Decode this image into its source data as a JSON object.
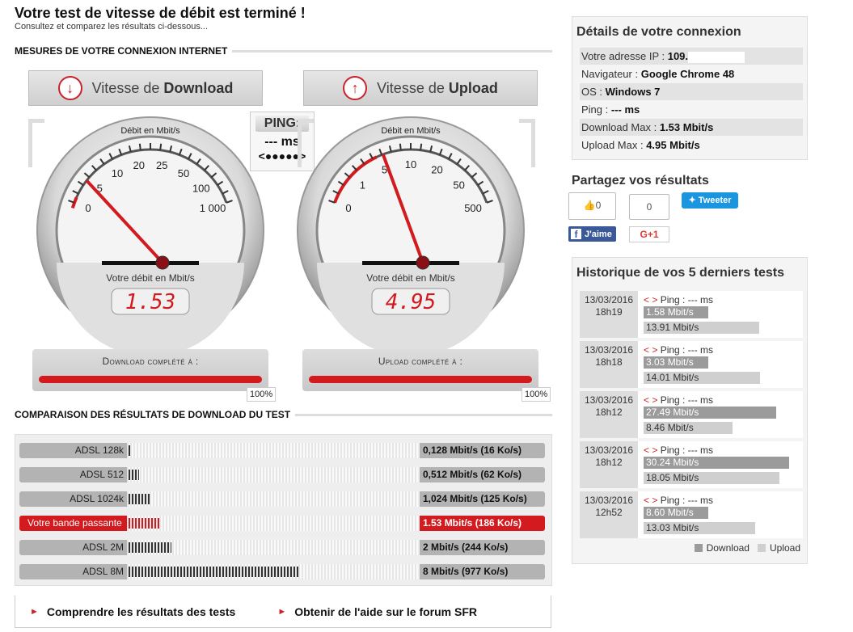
{
  "header": {
    "title": "Votre test de vitesse de débit est terminé !",
    "subtitle": "Consultez et comparez les résultats ci-dessous..."
  },
  "measures": {
    "section_title": "MESURES DE VOTRE CONNEXION INTERNET",
    "download": {
      "label_prefix": "Vitesse de",
      "label_bold": "Download",
      "arrow_icon": "arrow-down-icon",
      "dial_top_label": "Débit en Mbit/s",
      "ticks": [
        "0",
        "5",
        "10",
        "20",
        "25",
        "50",
        "100",
        "1 000"
      ],
      "caption": "Votre débit en Mbit/s",
      "value": "1.53",
      "progress_label": "Download complété à :",
      "progress_value": 1.0,
      "progress_pct": "100%"
    },
    "upload": {
      "label_prefix": "Vitesse de",
      "label_bold": "Upload",
      "arrow_icon": "arrow-up-icon",
      "dial_top_label": "Débit en Mbit/s",
      "ticks": [
        "0",
        "1",
        "5",
        "10",
        "20",
        "50",
        "500"
      ],
      "caption": "Votre débit en Mbit/s",
      "value": "4.95",
      "progress_label": "Upload complété à :",
      "progress_value": 1.0,
      "progress_pct": "100%"
    },
    "ping": {
      "label": "PING:",
      "value": "--- ms",
      "anim": "<●●●●●>"
    }
  },
  "comparison": {
    "section_title": "COMPARAISON DES RÉSULTATS DE DOWNLOAD DU TEST",
    "rows": [
      {
        "label": "ADSL 128k",
        "value": "0,128 Mbit/s (16 Ko/s)",
        "mbps": 0.128,
        "highlight": false
      },
      {
        "label": "ADSL 512",
        "value": "0,512 Mbit/s (62 Ko/s)",
        "mbps": 0.512,
        "highlight": false
      },
      {
        "label": "ADSL 1024k",
        "value": "1,024 Mbit/s (125 Ko/s)",
        "mbps": 1.024,
        "highlight": false
      },
      {
        "label": "Votre bande passante",
        "value": "1.53 Mbit/s (186 Ko/s)",
        "mbps": 1.53,
        "highlight": true
      },
      {
        "label": "ADSL 2M",
        "value": "2 Mbit/s (244 Ko/s)",
        "mbps": 2,
        "highlight": false
      },
      {
        "label": "ADSL 8M",
        "value": "8 Mbit/s (977 Ko/s)",
        "mbps": 8,
        "highlight": false
      }
    ]
  },
  "links": {
    "understand": "Comprendre les résultats des tests",
    "forum": "Obtenir de l'aide sur le forum SFR"
  },
  "details": {
    "title": "Détails de votre connexion",
    "rows": [
      {
        "label": "Votre adresse IP : ",
        "value": "109."
      },
      {
        "label": "Navigateur : ",
        "value": "Google Chrome 48"
      },
      {
        "label": "OS : ",
        "value": "Windows 7"
      },
      {
        "label": "Ping : ",
        "value": "--- ms"
      },
      {
        "label": "Download Max : ",
        "value": "1.53 Mbit/s"
      },
      {
        "label": "Upload Max : ",
        "value": "4.95 Mbit/s"
      }
    ]
  },
  "share": {
    "title": "Partagez vos résultats",
    "like_count": "0",
    "gplus_count": "0",
    "fb_label": "J'aime",
    "gplus_label": "G+1",
    "tweet_label": "Tweeter"
  },
  "history": {
    "title": "Historique de vos 5 derniers tests",
    "ping_prefix": "< >",
    "ping_text": "Ping : --- ms",
    "entries": [
      {
        "date": "13/03/2016",
        "time": "18h19",
        "download": "1.58 Mbit/s",
        "upload": "13.91 Mbit/s",
        "dl_mbps": 1.58,
        "ul_mbps": 13.91
      },
      {
        "date": "13/03/2016",
        "time": "18h18",
        "download": "3.03 Mbit/s",
        "upload": "14.01 Mbit/s",
        "dl_mbps": 3.03,
        "ul_mbps": 14.01
      },
      {
        "date": "13/03/2016",
        "time": "18h12",
        "download": "27.49 Mbit/s",
        "upload": "8.46 Mbit/s",
        "dl_mbps": 27.49,
        "ul_mbps": 8.46
      },
      {
        "date": "13/03/2016",
        "time": "18h12",
        "download": "30.24 Mbit/s",
        "upload": "18.05 Mbit/s",
        "dl_mbps": 30.24,
        "ul_mbps": 18.05
      },
      {
        "date": "13/03/2016",
        "time": "12h52",
        "download": "8.60 Mbit/s",
        "upload": "13.03 Mbit/s",
        "dl_mbps": 8.6,
        "ul_mbps": 13.03
      }
    ],
    "legend_download": "Download",
    "legend_upload": "Upload"
  },
  "colors": {
    "accent_red": "#d21a1f",
    "facebook": "#3b5998",
    "twitter": "#1b95e0"
  }
}
